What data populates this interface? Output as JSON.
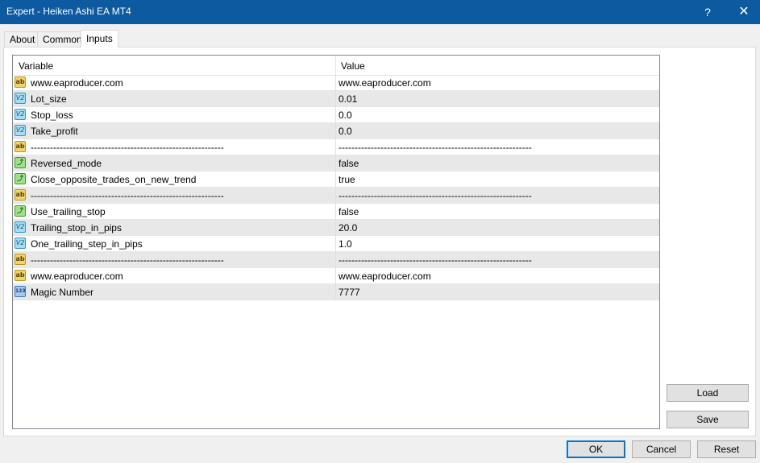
{
  "window": {
    "title": "Expert - Heiken Ashi EA MT4",
    "help_label": "?",
    "close_label": "✕"
  },
  "tabs": [
    {
      "label": "About"
    },
    {
      "label": "Common"
    },
    {
      "label": "Inputs",
      "active": true
    }
  ],
  "table": {
    "headers": {
      "variable": "Variable",
      "value": "Value"
    },
    "rows": [
      {
        "icon": "string-icon",
        "icon_text": "ab",
        "variable": "www.eaproducer.com",
        "value": "www.eaproducer.com"
      },
      {
        "icon": "double-icon",
        "icon_text": "V2",
        "variable": "Lot_size",
        "value": "0.01"
      },
      {
        "icon": "double-icon",
        "icon_text": "V2",
        "variable": "Stop_loss",
        "value": "0.0"
      },
      {
        "icon": "double-icon",
        "icon_text": "V2",
        "variable": "Take_profit",
        "value": "0.0"
      },
      {
        "icon": "string-icon",
        "icon_text": "ab",
        "variable": "------------------------------------------------------------",
        "value": "------------------------------------------------------------"
      },
      {
        "icon": "bool-icon",
        "icon_text": "⤴",
        "variable": "Reversed_mode",
        "value": "false"
      },
      {
        "icon": "bool-icon",
        "icon_text": "⤴",
        "variable": "Close_opposite_trades_on_new_trend",
        "value": "true"
      },
      {
        "icon": "string-icon",
        "icon_text": "ab",
        "variable": "------------------------------------------------------------",
        "value": "------------------------------------------------------------"
      },
      {
        "icon": "bool-icon",
        "icon_text": "⤴",
        "variable": "Use_trailing_stop",
        "value": "false"
      },
      {
        "icon": "double-icon",
        "icon_text": "V2",
        "variable": "Trailing_stop_in_pips",
        "value": "20.0"
      },
      {
        "icon": "double-icon",
        "icon_text": "V2",
        "variable": "One_trailing_step_in_pips",
        "value": "1.0"
      },
      {
        "icon": "string-icon",
        "icon_text": "ab",
        "variable": "------------------------------------------------------------",
        "value": "------------------------------------------------------------"
      },
      {
        "icon": "string-icon",
        "icon_text": "ab",
        "variable": "www.eaproducer.com",
        "value": "www.eaproducer.com"
      },
      {
        "icon": "int-icon",
        "icon_text": "123",
        "variable": "Magic Number",
        "value": "7777"
      }
    ]
  },
  "side_buttons": {
    "load": "Load",
    "save": "Save"
  },
  "footer_buttons": {
    "ok": "OK",
    "cancel": "Cancel",
    "reset": "Reset"
  },
  "colors": {
    "titlebar": "#0d5aa0",
    "alt_row": "#e8e8e8",
    "default_button_border": "#0078d7"
  }
}
